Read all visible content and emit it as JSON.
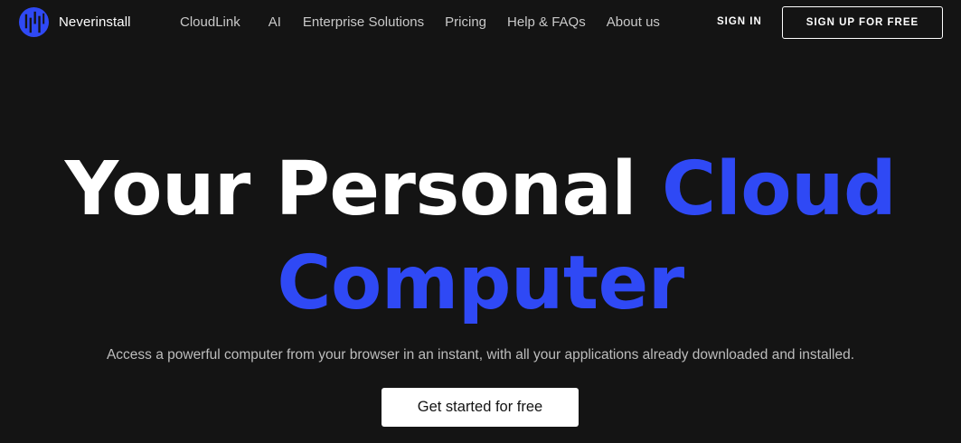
{
  "brand": {
    "name": "Neverinstall",
    "logo_icon": "neverinstall-logo-icon",
    "logo_color": "#2f49f5"
  },
  "nav": {
    "items": [
      {
        "label": "CloudLink"
      },
      {
        "label": "AI"
      },
      {
        "label": "Enterprise Solutions"
      },
      {
        "label": "Pricing"
      },
      {
        "label": "Help & FAQs"
      },
      {
        "label": "About us"
      }
    ],
    "signin_label": "SIGN IN",
    "signup_label": "SIGN UP FOR FREE"
  },
  "hero": {
    "title_plain": "Your Personal",
    "title_accent_1": "Cloud",
    "title_accent_2": "Computer",
    "subtitle": "Access a powerful computer from your browser in an instant, with all your applications already downloaded and installed.",
    "cta_label": "Get started for free"
  },
  "colors": {
    "background": "#141414",
    "accent": "#2f49f5",
    "text": "#ffffff",
    "muted_text": "#bdbdbd"
  }
}
